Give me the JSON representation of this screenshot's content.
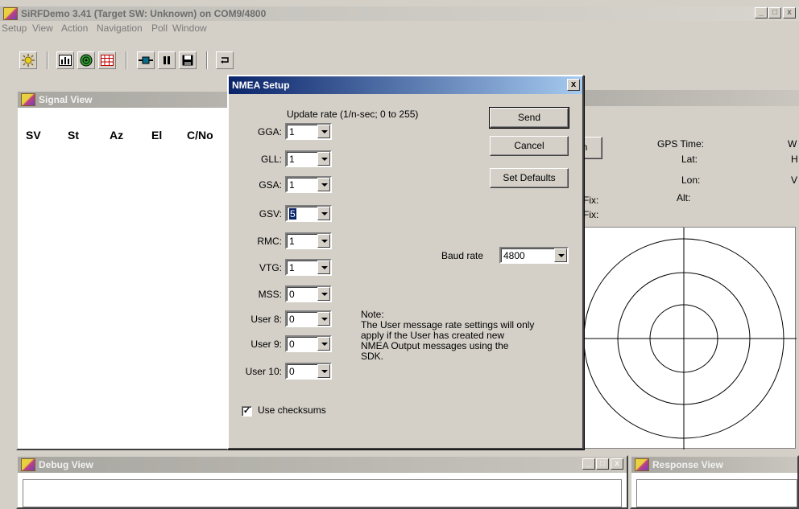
{
  "main_window": {
    "title": "SiRFDemo 3.41 (Target SW: Unknown) on COM9/4800",
    "min_label": "_",
    "max_label": "□",
    "close_label": "x"
  },
  "menu": [
    "Setup",
    "View",
    "Action",
    "Navigation",
    "Poll",
    "Window"
  ],
  "toolbar": {
    "icons": [
      "settings-sun-icon",
      "bar-chart-icon",
      "radar-icon",
      "grid-table-icon",
      "connect-icon",
      "pause-icon",
      "save-icon",
      "return-icon"
    ]
  },
  "signal_view": {
    "title": "Signal View",
    "columns": [
      "SV",
      "St",
      "Az",
      "El",
      "C/No"
    ]
  },
  "nav_panel": {
    "button_fragment": "in",
    "labels_left": [
      "Fix:",
      "Fix:"
    ],
    "labels_mid": [
      "GPS Time:",
      "Lat:",
      "Lon:",
      "Alt:"
    ],
    "labels_right": [
      "W",
      "H",
      "V"
    ]
  },
  "debug_view": {
    "title": "Debug View",
    "min_label": "_",
    "max_label": "□",
    "close_label": "x"
  },
  "response_view": {
    "title": "Response View"
  },
  "nmea_dialog": {
    "title": "NMEA Setup",
    "close_label": "x",
    "update_rate_label": "Update rate (1/n-sec; 0 to 255)",
    "rows": [
      {
        "label": "GGA:",
        "value": "1"
      },
      {
        "label": "GLL:",
        "value": "1"
      },
      {
        "label": "GSA:",
        "value": "1"
      },
      {
        "label": "GSV:",
        "value": "5"
      },
      {
        "label": "RMC:",
        "value": "1"
      },
      {
        "label": "VTG:",
        "value": "1"
      },
      {
        "label": "MSS:",
        "value": "0"
      },
      {
        "label": "User 8:",
        "value": "0"
      },
      {
        "label": "User 9:",
        "value": "0"
      },
      {
        "label": "User 10:",
        "value": "0"
      }
    ],
    "send_label": "Send",
    "cancel_label": "Cancel",
    "set_defaults_label": "Set Defaults",
    "baud_label": "Baud rate",
    "baud_value": "4800",
    "note_lines": [
      "Note:",
      "The User message rate settings will only",
      "apply if the User has created new",
      "NMEA Output messages using the",
      "SDK."
    ],
    "checksum_label": "Use checksums",
    "checksum_checked": true,
    "checkmark": "✓"
  },
  "colors": {
    "dialog_title_start": "#0a246a",
    "dialog_title_end": "#a6caf0",
    "inactive_title": "#a8a6a0",
    "face": "#d4d0c8"
  }
}
